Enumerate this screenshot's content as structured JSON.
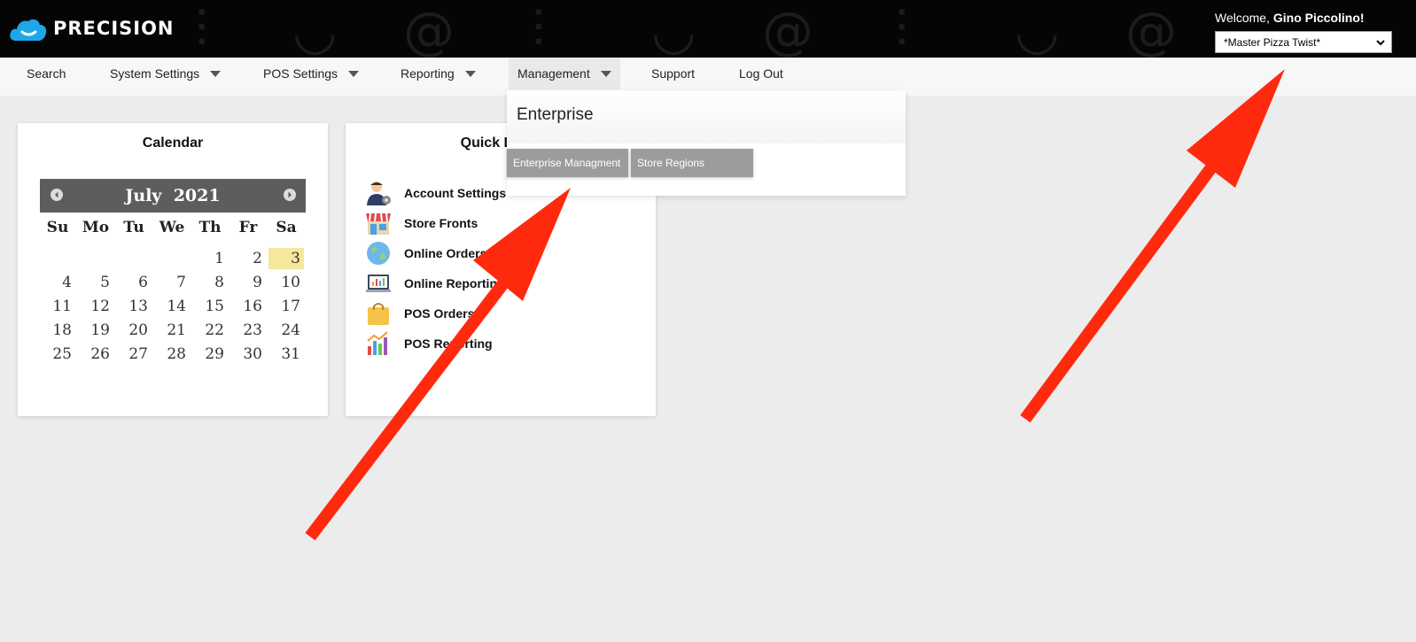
{
  "header": {
    "logo_text": "PRECISION",
    "welcome_prefix": "Welcome, ",
    "welcome_name": "Gino Piccolino!",
    "store_selected": "*Master Pizza Twist*"
  },
  "nav": {
    "items": [
      {
        "label": "Search"
      },
      {
        "label": "System Settings"
      },
      {
        "label": "POS Settings"
      },
      {
        "label": "Reporting"
      },
      {
        "label": "Management"
      },
      {
        "label": "Support"
      },
      {
        "label": "Log Out"
      }
    ]
  },
  "dropdown": {
    "heading": "Enterprise",
    "buttons": [
      {
        "label": "Enterprise Managment"
      },
      {
        "label": "Store Regions"
      }
    ]
  },
  "calendar": {
    "title": "Calendar",
    "month": "July",
    "year": "2021",
    "weekdays": [
      "Su",
      "Mo",
      "Tu",
      "We",
      "Th",
      "Fr",
      "Sa"
    ],
    "weeks": [
      [
        "",
        "",
        "",
        "",
        "1",
        "2",
        "3"
      ],
      [
        "4",
        "5",
        "6",
        "7",
        "8",
        "9",
        "10"
      ],
      [
        "11",
        "12",
        "13",
        "14",
        "15",
        "16",
        "17"
      ],
      [
        "18",
        "19",
        "20",
        "21",
        "22",
        "23",
        "24"
      ],
      [
        "25",
        "26",
        "27",
        "28",
        "29",
        "30",
        "31"
      ]
    ],
    "today": "3",
    "today_color": "#f5e79b"
  },
  "quick_links": {
    "title": "Quick Links",
    "items": [
      {
        "label": "Account Settings",
        "icon": "account-settings-icon"
      },
      {
        "label": "Store Fronts",
        "icon": "store-front-icon"
      },
      {
        "label": "Online Orders",
        "icon": "globe-icon"
      },
      {
        "label": "Online Reporting",
        "icon": "laptop-chart-icon"
      },
      {
        "label": "POS Orders",
        "icon": "shopping-bag-icon"
      },
      {
        "label": "POS Reporting",
        "icon": "bar-chart-icon"
      }
    ]
  },
  "colors": {
    "topbar": "#050505",
    "accent_cloud": "#1ea7e8",
    "annotation_arrow": "#ff2a0e",
    "dropdown_button": "#9c9c9e"
  }
}
